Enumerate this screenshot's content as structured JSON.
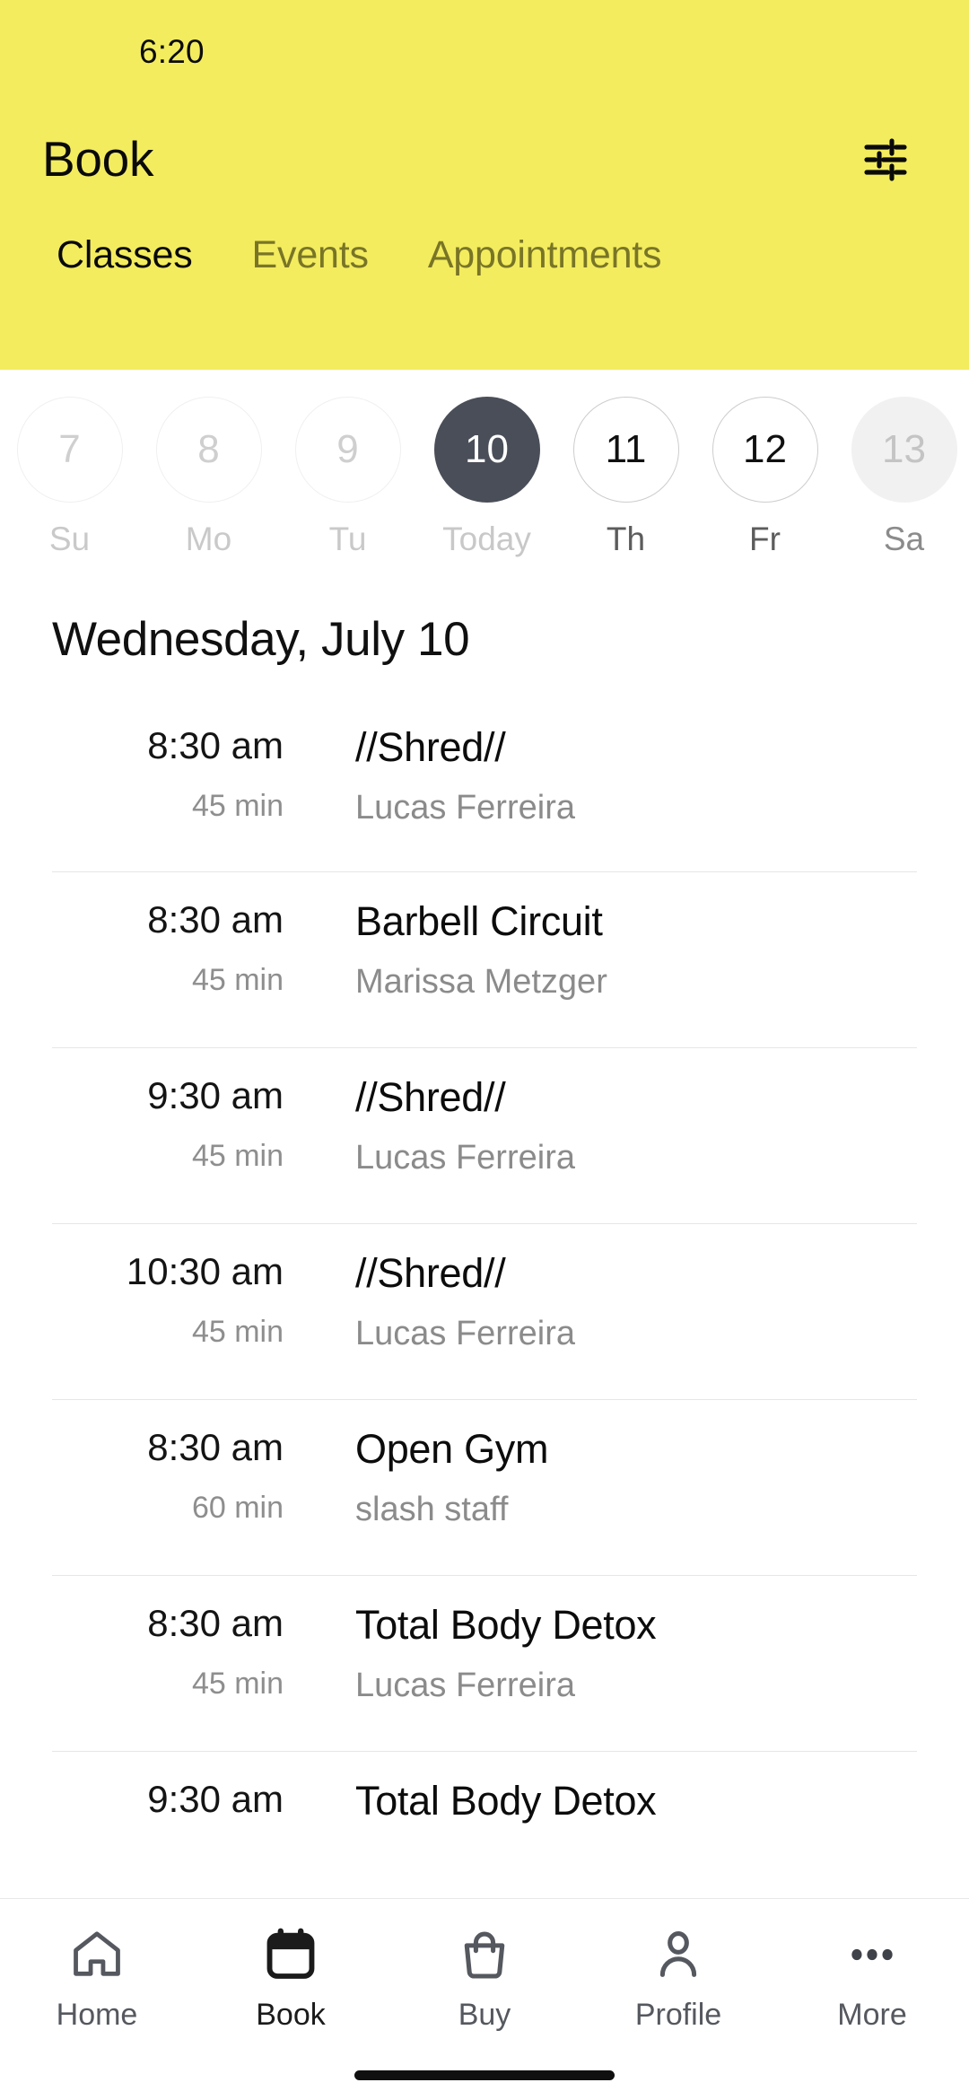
{
  "colors": {
    "brand_yellow": "#f3ec5f",
    "selected_date": "#4a4e58",
    "muted_text": "#8b8b8b",
    "divider": "#e6e6e6"
  },
  "status_bar": {
    "time": "6:20"
  },
  "header": {
    "title": "Book",
    "filter_icon": "sliders-icon",
    "tabs": [
      {
        "label": "Classes",
        "active": true
      },
      {
        "label": "Events",
        "active": false
      },
      {
        "label": "Appointments",
        "active": false
      }
    ]
  },
  "date_strip": {
    "dates": [
      {
        "day": "7",
        "weekday": "Su",
        "state": "past"
      },
      {
        "day": "8",
        "weekday": "Mo",
        "state": "past"
      },
      {
        "day": "9",
        "weekday": "Tu",
        "state": "past"
      },
      {
        "day": "10",
        "weekday": "Today",
        "state": "selected"
      },
      {
        "day": "11",
        "weekday": "Th",
        "state": "future"
      },
      {
        "day": "12",
        "weekday": "Fr",
        "state": "future"
      },
      {
        "day": "13",
        "weekday": "Sa",
        "state": "muted"
      }
    ]
  },
  "day_heading": "Wednesday, July 10",
  "classes": [
    {
      "time": "8:30 am",
      "duration": "45 min",
      "name": "//Shred//",
      "staff": "Lucas Ferreira"
    },
    {
      "time": "8:30 am",
      "duration": "45 min",
      "name": "Barbell Circuit",
      "staff": "Marissa Metzger"
    },
    {
      "time": "9:30 am",
      "duration": "45 min",
      "name": "//Shred//",
      "staff": "Lucas Ferreira"
    },
    {
      "time": "10:30 am",
      "duration": "45 min",
      "name": "//Shred//",
      "staff": "Lucas Ferreira"
    },
    {
      "time": "8:30 am",
      "duration": "60 min",
      "name": "Open Gym",
      "staff": "slash staff"
    },
    {
      "time": "8:30 am",
      "duration": "45 min",
      "name": "Total Body Detox",
      "staff": "Lucas Ferreira"
    },
    {
      "time": "9:30 am",
      "duration": "",
      "name": "Total Body Detox",
      "staff": ""
    }
  ],
  "bottom_nav": {
    "items": [
      {
        "label": "Home",
        "icon": "home-icon",
        "active": false
      },
      {
        "label": "Book",
        "icon": "calendar-icon",
        "active": true
      },
      {
        "label": "Buy",
        "icon": "bag-icon",
        "active": false
      },
      {
        "label": "Profile",
        "icon": "person-icon",
        "active": false
      },
      {
        "label": "More",
        "icon": "ellipsis-icon",
        "active": false
      }
    ]
  }
}
